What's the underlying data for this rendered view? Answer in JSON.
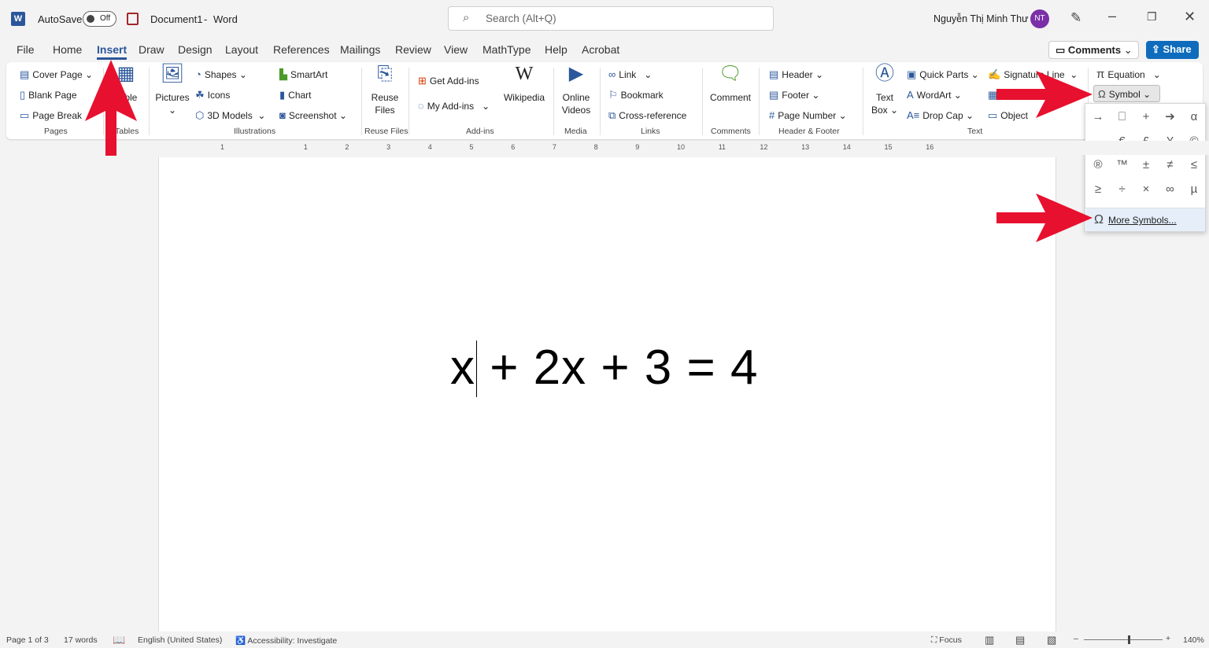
{
  "titlebar": {
    "autosave": "AutoSave",
    "toggle": "Off",
    "doc": "Document1",
    "sep": "-",
    "app": "Word",
    "search_placeholder": "Search (Alt+Q)",
    "user": "Nguyễn Thị Minh Thư",
    "initials": "NT"
  },
  "tabs": [
    "File",
    "Home",
    "Insert",
    "Draw",
    "Design",
    "Layout",
    "References",
    "Mailings",
    "Review",
    "View",
    "MathType",
    "Help",
    "Acrobat"
  ],
  "active_tab": "Insert",
  "actions": {
    "comments": "Comments",
    "share": "Share"
  },
  "ribbon": {
    "pages": {
      "items": [
        "Cover Page",
        "Blank Page",
        "Page Break"
      ],
      "label": "Pages"
    },
    "tables": {
      "item": "Table",
      "label": "Tables"
    },
    "illustrations": {
      "pictures": "Pictures",
      "items": [
        "Shapes",
        "Icons",
        "3D Models",
        "SmartArt",
        "Chart",
        "Screenshot"
      ],
      "label": "Illustrations"
    },
    "reuse": {
      "item1": "Reuse",
      "item2": "Files",
      "label": "Reuse Files"
    },
    "addins": {
      "items": [
        "Get Add-ins",
        "My Add-ins"
      ],
      "wikipedia": "Wikipedia",
      "label": "Add-ins"
    },
    "media": {
      "item1": "Online",
      "item2": "Videos",
      "label": "Media"
    },
    "links": {
      "items": [
        "Link",
        "Bookmark",
        "Cross-reference"
      ],
      "label": "Links"
    },
    "comments": {
      "item": "Comment",
      "label": "Comments"
    },
    "header_footer": {
      "items": [
        "Header",
        "Footer",
        "Page Number"
      ],
      "label": "Header & Footer"
    },
    "text": {
      "textbox1": "Text",
      "textbox2": "Box",
      "items": [
        "Quick Parts",
        "WordArt",
        "Drop Cap",
        "Signature Line",
        "Object"
      ],
      "label": "Text"
    },
    "symbols": {
      "equation": "Equation",
      "symbol": "Symbol"
    }
  },
  "symbol_menu": {
    "symbols": [
      "→",
      "⎕",
      "+",
      "➔",
      "α",
      "‐",
      "€",
      "£",
      "¥",
      "©",
      "®",
      "™",
      "±",
      "≠",
      "≤",
      "≥",
      "÷",
      "×",
      "∞",
      "µ"
    ],
    "more": "More Symbols..."
  },
  "ruler_numbers": [
    "1",
    "1",
    "2",
    "3",
    "4",
    "5",
    "6",
    "7",
    "8",
    "9",
    "10",
    "11",
    "12",
    "13",
    "14",
    "15",
    "16"
  ],
  "document": {
    "text": "x + 2x + 3 = 4"
  },
  "status": {
    "page": "Page 1 of 3",
    "words": "17 words",
    "language": "English (United States)",
    "accessibility": "Accessibility: Investigate",
    "focus": "Focus",
    "zoom": "140%",
    "zoom_level": 140
  },
  "colors": {
    "accent": "#2b579a",
    "share": "#0f6cbd",
    "arrow": "#e8102f",
    "avatar": "#7b2fa8"
  }
}
